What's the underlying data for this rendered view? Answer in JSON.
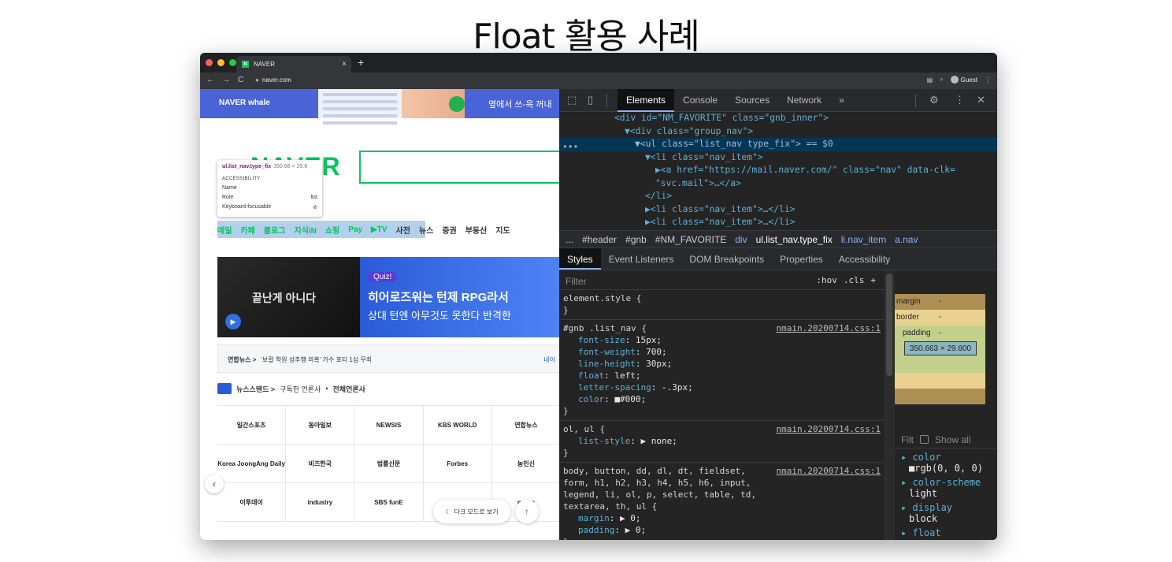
{
  "slide": {
    "title": "Float 활용 사례"
  },
  "browser": {
    "tab_title": "NAVER",
    "tab_icon": "N",
    "url": "naver.com",
    "guest_label": "Guest"
  },
  "page": {
    "whale_logo": "NAVER whale",
    "whale_promo": "옆에서 쓰-윽 꺼내",
    "logo": "NAVER",
    "tooltip": {
      "selector": "ul.list_nav.type_fix",
      "size": "350.66 × 29.6",
      "heading": "ACCESSIBILITY",
      "name_label": "Name",
      "role_label": "Role",
      "role_value": "list",
      "focus_label": "Keyboard-focusable"
    },
    "gnb": [
      {
        "label": "메일",
        "green": true
      },
      {
        "label": "카페",
        "green": true
      },
      {
        "label": "블로그",
        "green": true
      },
      {
        "label": "지식iN",
        "green": true
      },
      {
        "label": "쇼핑",
        "green": true
      },
      {
        "label": "Pay",
        "green": true
      },
      {
        "label": "▶TV",
        "green": true
      },
      {
        "label": "사전",
        "green": false
      },
      {
        "label": "뉴스",
        "green": false
      },
      {
        "label": "증권",
        "green": false
      },
      {
        "label": "부동산",
        "green": false
      },
      {
        "label": "지도",
        "green": false
      }
    ],
    "banner": {
      "left_text": "끝난게 아니다",
      "quiz": "Quiz!",
      "line1": "히어로즈워는 턴제 RPG라서",
      "line2": "상대 턴엔 아무것도 못한다 반격한"
    },
    "news": {
      "source": "연합뉴스 >",
      "headline": "'보컬 학원 성추행 의혹' 가수 포티 1심 무죄",
      "right": "네이"
    },
    "newsstand": {
      "title": "뉴스스탠드 >",
      "sub": "구독한 언론사",
      "all": "전체언론사"
    },
    "press_grid": [
      [
        "일간스포츠",
        "동아일보",
        "NEWSIS",
        "KBS WORLD",
        "연합뉴스"
      ],
      [
        "Korea JoongAng Daily",
        "비즈한국",
        "법률신문",
        "Forbes",
        "농민신"
      ],
      [
        "이투데이",
        "industry",
        "SBS funE",
        "",
        "metro"
      ]
    ],
    "darkmode": "다크 모드로 보기"
  },
  "devtools": {
    "tabs": [
      "Elements",
      "Console",
      "Sources",
      "Network",
      "»"
    ],
    "active_tab": "Elements",
    "dom_lines": [
      {
        "indent": 0,
        "html": "<div id=\"NM_FAVORITE\" class=\"gnb_inner\">"
      },
      {
        "indent": 1,
        "html": "▼<div class=\"group_nav\">"
      },
      {
        "indent": 2,
        "html": "▼<ul class=\"list_nav type_fix\"> == $0"
      },
      {
        "indent": 3,
        "html": "▼<li class=\"nav_item\">"
      },
      {
        "indent": 4,
        "html": "▶<a href=\"https://mail.naver.com/\" class=\"nav\" data-clk="
      },
      {
        "indent": 4,
        "html": "\"svc.mail\">…</a>"
      },
      {
        "indent": 3,
        "html": "</li>"
      },
      {
        "indent": 3,
        "html": "▶<li class=\"nav_item\">…</li>"
      },
      {
        "indent": 3,
        "html": "▶<li class=\"nav_item\">…</li>"
      },
      {
        "indent": 3,
        "html": "▶<li class=\"nav_item\">…</li>"
      }
    ],
    "breadcrumbs": [
      "...",
      "#header",
      "#gnb",
      "#NM_FAVORITE",
      "div",
      "ul.list_nav.type_fix",
      "li.nav_item",
      "a.nav"
    ],
    "subtabs": [
      "Styles",
      "Event Listeners",
      "DOM Breakpoints",
      "Properties",
      "Accessibility"
    ],
    "filter_placeholder": "Filter",
    "filter_opts": [
      ":hov",
      ".cls",
      "+"
    ],
    "rules": [
      {
        "selector": "element.style {",
        "src": "",
        "props": []
      },
      {
        "selector": "#gnb .list_nav {",
        "src": "nmain.20200714.css:1",
        "props": [
          [
            "font-size",
            "15px;"
          ],
          [
            "font-weight",
            "700;"
          ],
          [
            "line-height",
            "30px;"
          ],
          [
            "float",
            "left;"
          ],
          [
            "letter-spacing",
            "-.3px;"
          ],
          [
            "color",
            "■#000;"
          ]
        ]
      },
      {
        "selector": "ol, ul {",
        "src": "nmain.20200714.css:1",
        "props": [
          [
            "list-style",
            "▶ none;"
          ]
        ]
      },
      {
        "selector": "body, button, dd, dl, dt, fieldset, form, h1, h2, h3, h4, h5, h6, input, legend, li, ol, p, select, table, td, textarea, th, ul {",
        "src": "nmain.20200714.css:1",
        "props": [
          [
            "margin",
            "▶ 0;"
          ],
          [
            "padding",
            "▶ 0;"
          ]
        ]
      }
    ],
    "box_model": {
      "margin": "margin",
      "border": "border",
      "padding": "padding",
      "dash": "-",
      "content": "350.663 × 29.600"
    },
    "computed": {
      "filter": "Filt",
      "show_all": "Show all",
      "items": [
        {
          "key": "color",
          "value": "■rgb(0, 0, 0)"
        },
        {
          "key": "color-scheme",
          "value": "light"
        },
        {
          "key": "display",
          "value": "block"
        },
        {
          "key": "float",
          "value": ""
        }
      ]
    }
  },
  "colors": {
    "naver_green": "#03c75a",
    "devtools_bg": "#242424",
    "selected_row": "#073655"
  }
}
